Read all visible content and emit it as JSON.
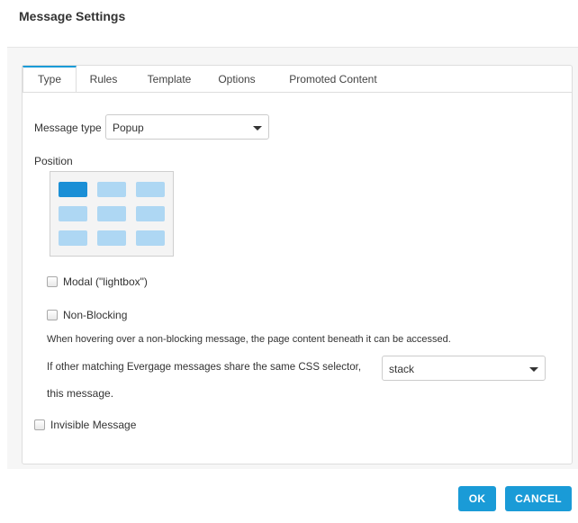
{
  "dialog": {
    "title": "Message Settings"
  },
  "tabs": [
    {
      "label": "Type",
      "active": true
    },
    {
      "label": "Rules",
      "active": false
    },
    {
      "label": "Template",
      "active": false
    },
    {
      "label": "Options",
      "active": false
    },
    {
      "label": "Promoted Content",
      "active": false
    }
  ],
  "message_type": {
    "label": "Message type",
    "value": "Popup"
  },
  "position": {
    "label": "Position",
    "selected_cell": "top-left"
  },
  "modal": {
    "label": "Modal (\"lightbox\")",
    "checked": false
  },
  "non_blocking": {
    "label": "Non-Blocking",
    "checked": false,
    "help": "When hovering over a non-blocking message, the page content beneath it can be accessed."
  },
  "css_selector": {
    "label_before": "If other matching Evergage messages share the same CSS selector,",
    "label_after": "this message.",
    "value": "stack"
  },
  "invisible": {
    "label": "Invisible Message",
    "checked": false
  },
  "footer": {
    "ok_label": "OK",
    "cancel_label": "CANCEL"
  },
  "colors": {
    "accent": "#1a9bd7",
    "cell": "#aed7f3",
    "cell_selected": "#1b8fd6"
  }
}
